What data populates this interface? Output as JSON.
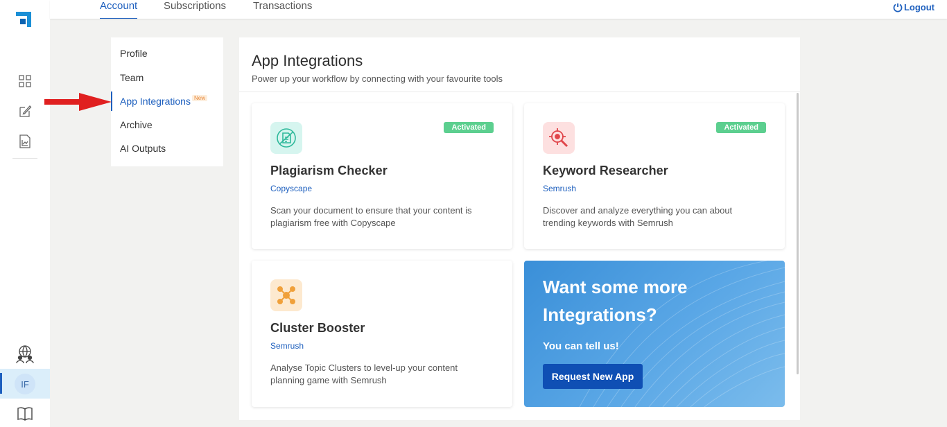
{
  "nav": {
    "tabs": [
      {
        "label": "Account",
        "active": true
      },
      {
        "label": "Subscriptions",
        "active": false
      },
      {
        "label": "Transactions",
        "active": false
      }
    ],
    "logout": "Logout"
  },
  "rail": {
    "avatar_initials": "IF",
    "icons": [
      "dashboard-icon",
      "edit-document-icon",
      "analytics-icon",
      "community-icon",
      "guide-book-icon"
    ]
  },
  "menu": {
    "items": [
      {
        "label": "Profile",
        "active": false
      },
      {
        "label": "Team",
        "active": false
      },
      {
        "label": "App Integrations",
        "active": true,
        "badge": "New"
      },
      {
        "label": "Archive",
        "active": false
      },
      {
        "label": "AI Outputs",
        "active": false
      }
    ]
  },
  "panel": {
    "title": "App Integrations",
    "subtitle": "Power up your workflow by connecting with your favourite tools"
  },
  "cards": [
    {
      "name": "Plagiarism Checker",
      "provider": "Copyscape",
      "status": "Activated",
      "description": "Scan your document to ensure that your content is plagiarism free with Copyscape",
      "icon": "plagiarism-icon",
      "icon_bg": "#d6f5ef",
      "icon_color": "#2fb99b"
    },
    {
      "name": "Keyword Researcher",
      "provider": "Semrush",
      "status": "Activated",
      "description": "Discover and analyze everything you can about trending keywords with Semrush",
      "icon": "keyword-target-icon",
      "icon_bg": "#fde0e0",
      "icon_color": "#e0454a"
    },
    {
      "name": "Cluster Booster",
      "provider": "Semrush",
      "status": "",
      "description": "Analyse Topic Clusters to level-up your content planning game with Semrush",
      "icon": "cluster-icon",
      "icon_bg": "#fde9cf",
      "icon_color": "#f0a03a"
    }
  ],
  "promo": {
    "headline": "Want some more Integrations?",
    "tell": "You can tell us!",
    "button": "Request New App"
  },
  "colors": {
    "accent": "#1d5fbe",
    "activated": "#5ccf8f",
    "page_bg": "#f2f2f0"
  }
}
